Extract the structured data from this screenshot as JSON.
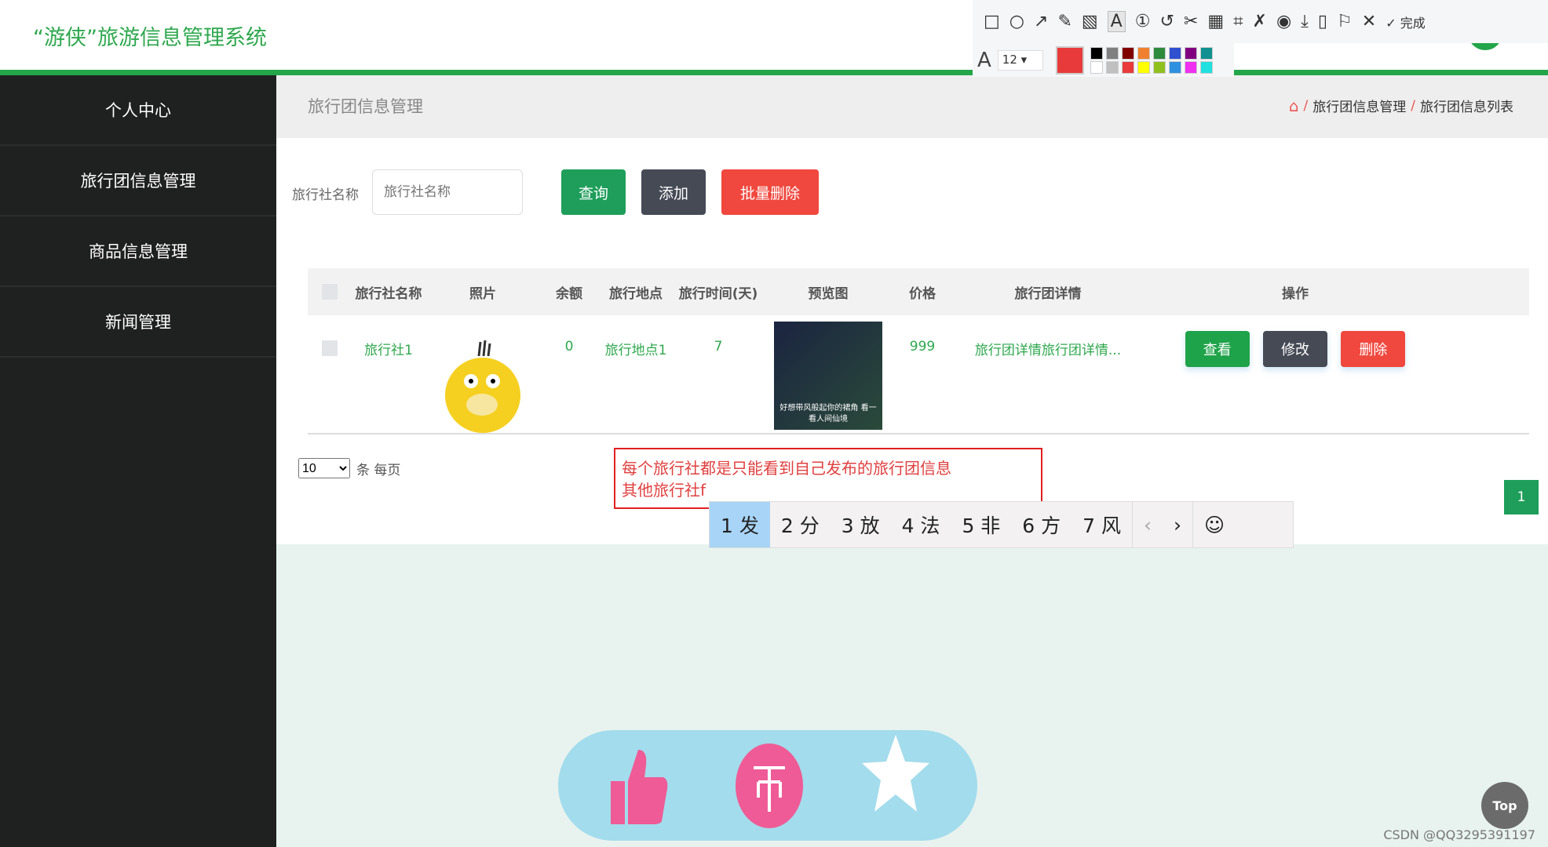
{
  "app": {
    "title": "“游侠”旅游信息管理系统"
  },
  "sidebar": {
    "items": [
      {
        "label": "个人中心"
      },
      {
        "label": "旅行团信息管理"
      },
      {
        "label": "商品信息管理"
      },
      {
        "label": "新闻管理"
      }
    ]
  },
  "breadcrumb": {
    "title": "旅行团信息管理",
    "items": [
      "旅行团信息管理",
      "旅行团信息列表"
    ],
    "separator": "/"
  },
  "search": {
    "label": "旅行社名称",
    "placeholder": "旅行社名称",
    "query": "查询",
    "add": "添加",
    "batch_delete": "批量删除"
  },
  "table": {
    "headers": [
      "旅行社名称",
      "照片",
      "余额",
      "旅行地点",
      "旅行时间(天)",
      "预览图",
      "价格",
      "旅行团详情",
      "操作"
    ],
    "rows": [
      {
        "name": "旅行社1",
        "balance": "0",
        "place": "旅行地点1",
        "days": "7",
        "price": "999",
        "detail": "旅行团详情旅行团详情...",
        "preview_caption": "好想带风般起你的裙角 看一看人间仙境"
      }
    ],
    "actions": {
      "view": "查看",
      "edit": "修改",
      "delete": "删除"
    }
  },
  "pagination": {
    "page_size": "10",
    "per_page_label": "条 每页",
    "current_page": "1"
  },
  "annotation": {
    "line1": "每个旅行社都是只能看到自己发布的旅行团信息",
    "line2": "其他旅行社f"
  },
  "ime": {
    "candidates": [
      "1 发",
      "2 分",
      "3 放",
      "4 法",
      "5 非",
      "6 方",
      "7 风"
    ],
    "prev": "‹",
    "next": "›",
    "emoji": "☺"
  },
  "toolbar": {
    "done": "完成",
    "font_size": "12",
    "font_icon": "A",
    "current_color": "#e83a3a",
    "palette": [
      "#000000",
      "#808080",
      "#800000",
      "#f08030",
      "#2e8b3e",
      "#3050d0",
      "#800080",
      "#109090",
      "#ffffff",
      "#c0c0c0",
      "#e83a3a",
      "#ffff00",
      "#90c020",
      "#3090e0",
      "#f030f0",
      "#20e0e0"
    ]
  },
  "widgets": {
    "top": "Top"
  },
  "watermark": "CSDN @QQ3295391197",
  "colors": {
    "brand": "#23a54a",
    "query": "#1e9e5a",
    "add": "#454a55",
    "danger": "#f0483e"
  }
}
